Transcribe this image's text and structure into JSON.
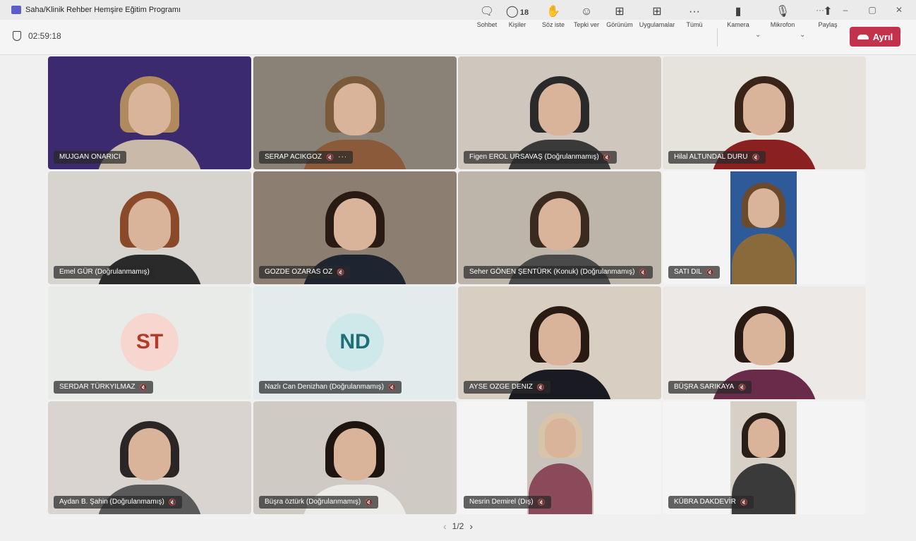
{
  "window": {
    "title": "Saha/Klinik Rehber Hemşire Eğitim Programı",
    "controls": [
      "···",
      "–",
      "▢",
      "✕"
    ]
  },
  "meeting": {
    "timer": "02:59:18",
    "people_count": "18"
  },
  "toolbar": {
    "chat": "Sohbet",
    "people": "Kişiler",
    "raise_hand": "Söz iste",
    "react": "Tepki ver",
    "view": "Görünüm",
    "apps": "Uygulamalar",
    "more": "Tümü",
    "camera": "Kamera",
    "mic": "Mikrofon",
    "share": "Paylaş",
    "leave": "Ayrıl"
  },
  "participants": [
    {
      "name": "MUJGAN ONARICI",
      "muted": false,
      "type": "video",
      "colors": {
        "bg": "#3b2a6e",
        "hair": "#b08a5c",
        "body": "#c9b9a8"
      }
    },
    {
      "name": "SERAP ACIKGOZ",
      "muted": true,
      "more": true,
      "type": "video",
      "colors": {
        "bg": "#8a8276",
        "hair": "#7a5a3a",
        "body": "#8a5a3a"
      }
    },
    {
      "name": "Figen EROL URSAVAŞ (Doğrulanmamış)",
      "muted": true,
      "type": "video",
      "colors": {
        "bg": "#cfc7bd",
        "hair": "#2a2a2a",
        "body": "#3a3a3a"
      }
    },
    {
      "name": "Hilal ALTUNDAL DURU",
      "muted": true,
      "type": "video",
      "colors": {
        "bg": "#e6e2dc",
        "hair": "#3a2418",
        "body": "#8a2020"
      }
    },
    {
      "name": "Emel GÜR (Doğrulanmamış)",
      "muted": false,
      "type": "video",
      "colors": {
        "bg": "#d7d3ce",
        "hair": "#8a4a2a",
        "body": "#2a2a2a"
      }
    },
    {
      "name": "GOZDE OZARAS OZ",
      "muted": true,
      "type": "video",
      "colors": {
        "bg": "#8c7f72",
        "hair": "#2a1a14",
        "body": "#1e2430"
      }
    },
    {
      "name": "Seher GÖNEN ŞENTÜRK (Konuk) (Doğrulanmamış)",
      "muted": true,
      "type": "video",
      "colors": {
        "bg": "#bdb5aa",
        "hair": "#3a2a20",
        "body": "#4a4a4a"
      }
    },
    {
      "name": "SATI DIL",
      "muted": true,
      "type": "inset",
      "colors": {
        "bg": "#2e5a9a",
        "hair": "#6a4a2a",
        "body": "#8a6a3a"
      }
    },
    {
      "name": "SERDAR TÜRKYILMAZ",
      "muted": true,
      "type": "avatar",
      "initials": "ST",
      "colors": {
        "bg": "#e9ebe8",
        "avatar_bg": "#f6d6ce",
        "avatar_fg": "#b23a26"
      }
    },
    {
      "name": "Nazlı Can Denizhan (Doğrulanmamış)",
      "muted": true,
      "type": "avatar",
      "initials": "ND",
      "colors": {
        "bg": "#e3ebec",
        "avatar_bg": "#cfe9ea",
        "avatar_fg": "#1e6f78"
      }
    },
    {
      "name": "AYSE OZGE DENIZ",
      "muted": true,
      "type": "video",
      "colors": {
        "bg": "#d8cfc2",
        "hair": "#2a1a14",
        "body": "#1a1a22"
      }
    },
    {
      "name": "BÜŞRA SARIKAYA",
      "muted": true,
      "type": "video",
      "colors": {
        "bg": "#ece9e6",
        "hair": "#2a1a14",
        "body": "#6a2a4a"
      }
    },
    {
      "name": "Aydan B. Şahin (Doğrulanmamış)",
      "muted": true,
      "type": "video",
      "colors": {
        "bg": "#d9d4cf",
        "hair": "#2a2626",
        "body": "#5a5a5a"
      }
    },
    {
      "name": "Büşra öztürk (Doğrulanmamış)",
      "muted": true,
      "type": "video",
      "colors": {
        "bg": "#cfcac4",
        "hair": "#1e1410",
        "body": "#ecebe8"
      }
    },
    {
      "name": "Nesrin Demirel (Dış)",
      "muted": true,
      "type": "inset",
      "colors": {
        "bg": "#c9c3bb",
        "hair": "#d8c4a8",
        "body": "#8a4a5a"
      }
    },
    {
      "name": "KÜBRA DAKDEVİR",
      "muted": true,
      "type": "inset",
      "colors": {
        "bg": "#d7d0c6",
        "hair": "#2a1e18",
        "body": "#3a3a3a"
      }
    }
  ],
  "pager": {
    "label": "1/2",
    "prev": "‹",
    "next": "›"
  }
}
